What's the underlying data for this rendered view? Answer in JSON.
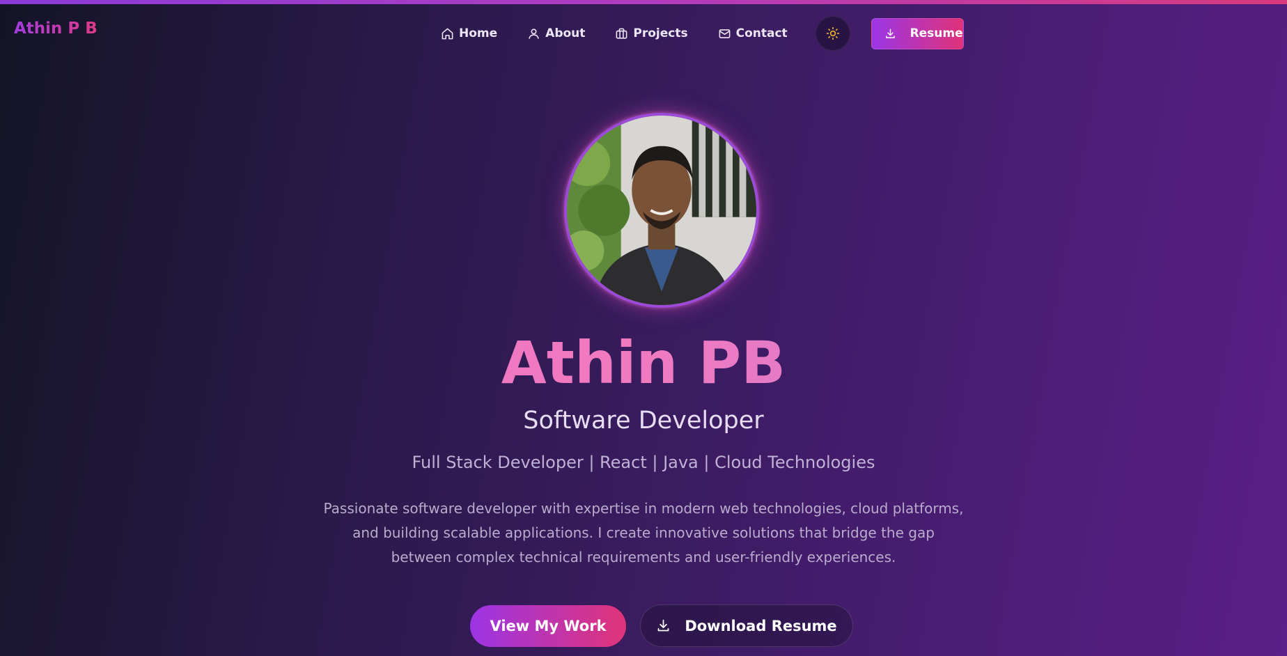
{
  "brand": "Athin P B",
  "nav": {
    "items": [
      {
        "label": "Home",
        "icon": "home-icon"
      },
      {
        "label": "About",
        "icon": "user-icon"
      },
      {
        "label": "Projects",
        "icon": "briefcase-icon"
      },
      {
        "label": "Contact",
        "icon": "mail-icon"
      }
    ],
    "theme_toggle_icon": "sun-icon",
    "resume_label": "Resume"
  },
  "hero": {
    "name": "Athin PB",
    "role": "Software Developer",
    "skills": "Full Stack Developer | React | Java | Cloud Technologies",
    "bio": "Passionate software developer with expertise in modern web technologies, cloud platforms, and building scalable applications. I create innovative solutions that bridge the gap between complex technical requirements and user-friendly experiences.",
    "primary_cta": "View My Work",
    "secondary_cta": "Download Resume"
  },
  "colors": {
    "accent_start": "#9b36e6",
    "accent_end": "#e03278",
    "sun": "#f2b233"
  }
}
